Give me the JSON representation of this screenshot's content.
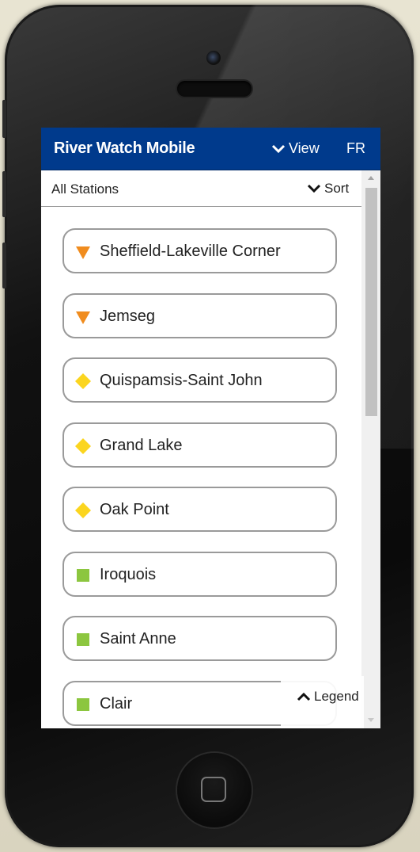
{
  "app": {
    "title": "River Watch Mobile",
    "view_label": "View",
    "language_label": "FR"
  },
  "filter": {
    "label": "All Stations",
    "sort_label": "Sort"
  },
  "stations": [
    {
      "name": "Sheffield-Lakeville Corner",
      "status_icon": "orange-triangle-icon",
      "color": "#f08c1e"
    },
    {
      "name": "Jemseg",
      "status_icon": "orange-triangle-icon",
      "color": "#f08c1e"
    },
    {
      "name": "Quispamsis-Saint John",
      "status_icon": "yellow-diamond-icon",
      "color": "#fbd51f"
    },
    {
      "name": "Grand Lake",
      "status_icon": "yellow-diamond-icon",
      "color": "#fbd51f"
    },
    {
      "name": "Oak Point",
      "status_icon": "yellow-diamond-icon",
      "color": "#fbd51f"
    },
    {
      "name": "Iroquois",
      "status_icon": "green-square-icon",
      "color": "#8cc63f"
    },
    {
      "name": "Saint Anne",
      "status_icon": "green-square-icon",
      "color": "#8cc63f"
    },
    {
      "name": "Clair",
      "status_icon": "green-square-icon",
      "color": "#8cc63f"
    }
  ],
  "legend": {
    "label": "Legend"
  },
  "colors": {
    "app_bar": "#003a8c"
  }
}
